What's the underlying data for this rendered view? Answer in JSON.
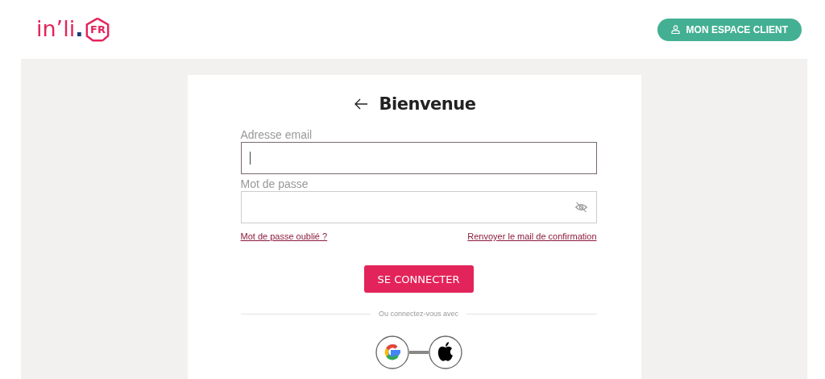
{
  "header": {
    "logo": {
      "text": "in’li",
      "dot": ".",
      "badge": "FR"
    },
    "account_button": "MON ESPACE CLIENT"
  },
  "login": {
    "title": "Bienvenue",
    "fields": [
      {
        "label": "Adresse email",
        "kind": "email",
        "focused": true
      },
      {
        "label": "Mot de passe",
        "kind": "password",
        "focused": false
      }
    ],
    "links": [
      "Mot de passe oublié ?",
      "Renvoyer le mail de confirmation"
    ],
    "submit": "SE CONNECTER",
    "divider": "Ou connectez-vous avec"
  }
}
